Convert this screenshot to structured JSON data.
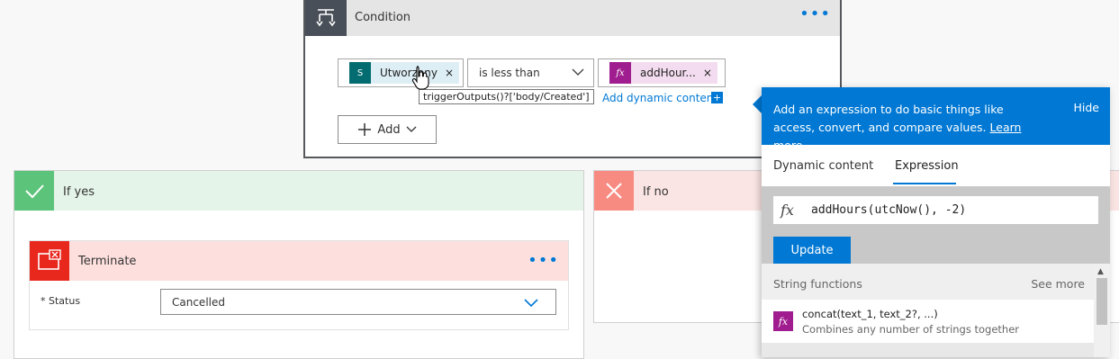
{
  "condition": {
    "title": "Condition",
    "more_label": "•••",
    "left_token": {
      "label": "Utworzony",
      "remove": "×"
    },
    "operator": "is less than",
    "right_token": {
      "label": "addHour...",
      "remove": "×"
    },
    "tooltip": "triggerOutputs()?['body/Created']",
    "add_dynamic": "Add dynamic content",
    "add_dynamic_plus": "+",
    "add_button": "Add"
  },
  "if_yes": {
    "title": "If yes",
    "terminate": {
      "title": "Terminate",
      "more_label": "•••",
      "status_label": "* Status",
      "status_value": "Cancelled"
    }
  },
  "if_no": {
    "title": "If no"
  },
  "expression_panel": {
    "description": "Add an expression to do basic things like access, convert, and compare values.",
    "learn_more": "Learn more",
    "hide": "Hide",
    "tabs": [
      "Dynamic content",
      "Expression"
    ],
    "active_tab": "Expression",
    "expression": "addHours(utcNow(), -2)",
    "update_label": "Update",
    "section_title": "String functions",
    "see_more": "See more",
    "functions": [
      {
        "name": "concat(text_1, text_2?, ...)",
        "description": "Combines any number of strings together"
      }
    ]
  },
  "colors": {
    "accent": "#0078d4",
    "yes_green": "#5cc37a",
    "no_red": "#f78b82",
    "terminate_red": "#e8271d",
    "expression_purple": "#a01d8f",
    "sharepoint_teal": "#036c70"
  }
}
